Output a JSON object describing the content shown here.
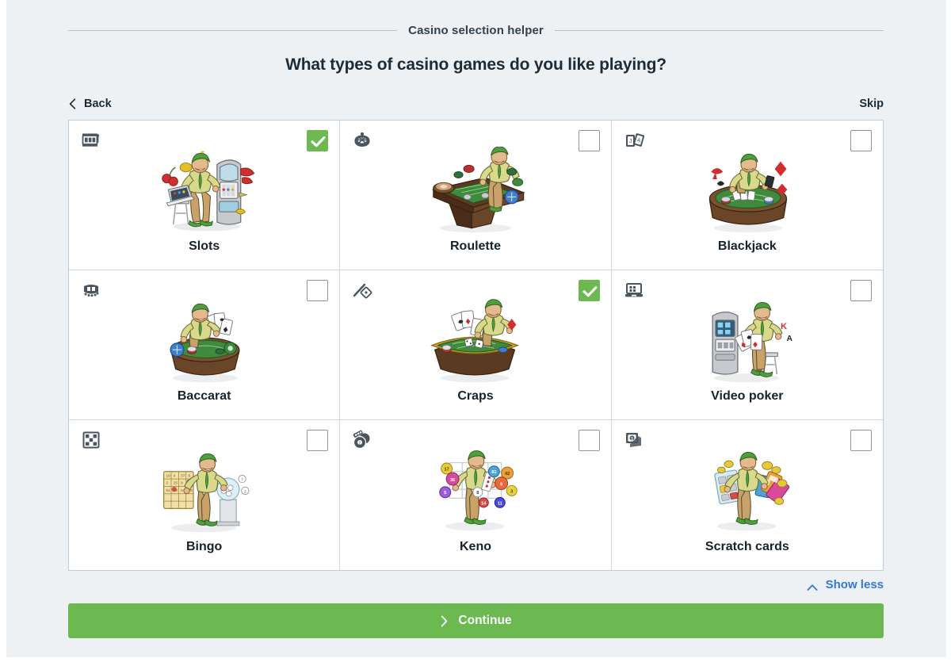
{
  "header": {
    "title": "Casino selection helper",
    "question": "What types of casino games do you like playing?"
  },
  "nav": {
    "back_label": "Back",
    "back_icon": "chevron-left-icon",
    "skip_label": "Skip"
  },
  "cards": [
    {
      "label": "Slots",
      "icon": "slot-machine-icon",
      "checked": true,
      "art": "slots"
    },
    {
      "label": "Roulette",
      "icon": "roulette-wheel-icon",
      "checked": false,
      "art": "roulette"
    },
    {
      "label": "Blackjack",
      "icon": "playing-cards-icon",
      "checked": false,
      "art": "blackjack"
    },
    {
      "label": "Baccarat",
      "icon": "card-fan-icon",
      "checked": false,
      "art": "baccarat"
    },
    {
      "label": "Craps",
      "icon": "dice-throw-icon",
      "checked": true,
      "art": "craps"
    },
    {
      "label": "Video poker",
      "icon": "video-poker-icon",
      "checked": false,
      "art": "videopoker"
    },
    {
      "label": "Bingo",
      "icon": "bingo-grid-icon",
      "checked": false,
      "art": "bingo"
    },
    {
      "label": "Keno",
      "icon": "keno-balls-icon",
      "checked": false,
      "art": "keno"
    },
    {
      "label": "Scratch cards",
      "icon": "scratch-card-icon",
      "checked": false,
      "art": "scratch"
    }
  ],
  "footer": {
    "show_less_label": "Show less",
    "show_less_icon": "chevron-up-icon",
    "continue_label": "Continue",
    "continue_icon": "chevron-right-icon"
  },
  "colors": {
    "page_bg": "#eef1f4",
    "card_bg": "#ffffff",
    "accent_green": "#6cb951",
    "link_blue": "#3478d6",
    "text_dark": "#1d2b36",
    "border": "#c4cbd2"
  }
}
